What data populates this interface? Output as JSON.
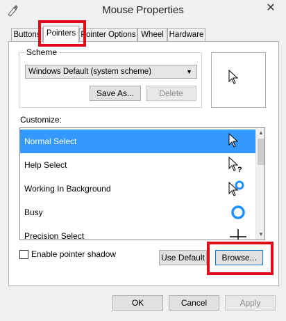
{
  "window": {
    "title": "Mouse Properties",
    "close_glyph": "✕"
  },
  "tabs": [
    {
      "label": "Buttons",
      "active": false
    },
    {
      "label": "Pointers",
      "active": true
    },
    {
      "label": "Pointer Options",
      "active": false
    },
    {
      "label": "Wheel",
      "active": false
    },
    {
      "label": "Hardware",
      "active": false
    }
  ],
  "scheme": {
    "legend": "Scheme",
    "selected": "Windows Default (system scheme)",
    "save_as_label": "Save As...",
    "delete_label": "Delete"
  },
  "customize": {
    "label": "Customize:",
    "rows": [
      {
        "label": "Normal Select",
        "icon": "arrow-cursor-icon",
        "selected": true
      },
      {
        "label": "Help Select",
        "icon": "help-cursor-icon",
        "selected": false
      },
      {
        "label": "Working In Background",
        "icon": "working-cursor-icon",
        "selected": false
      },
      {
        "label": "Busy",
        "icon": "busy-cursor-icon",
        "selected": false
      },
      {
        "label": "Precision Select",
        "icon": "crosshair-cursor-icon",
        "selected": false
      }
    ]
  },
  "shadow": {
    "label": "Enable pointer shadow",
    "checked": false
  },
  "buttons": {
    "use_default": "Use Default",
    "browse": "Browse...",
    "ok": "OK",
    "cancel": "Cancel",
    "apply": "Apply"
  },
  "colors": {
    "selection": "#3399ff",
    "highlight": "#e30b17",
    "busy_ring": "#1e90ff"
  }
}
